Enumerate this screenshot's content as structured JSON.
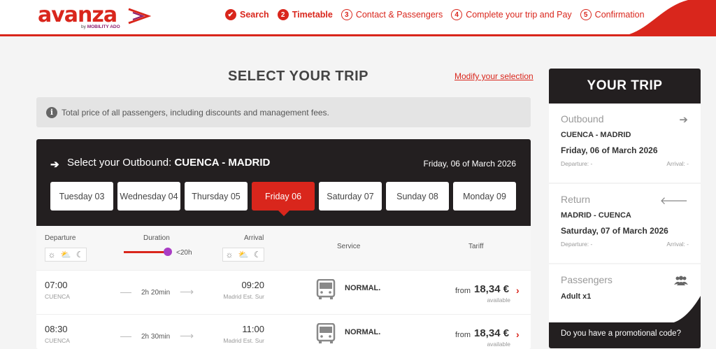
{
  "brand": {
    "name": "avanza",
    "sub_prefix": "by",
    "sub_brand": "MOBILITY ADO"
  },
  "steps": [
    {
      "num": "✔",
      "label": "Search",
      "state": "done"
    },
    {
      "num": "2",
      "label": "Timetable",
      "state": "active"
    },
    {
      "num": "3",
      "label": "Contact & Passengers",
      "state": "todo"
    },
    {
      "num": "4",
      "label": "Complete your trip and Pay",
      "state": "todo"
    },
    {
      "num": "5",
      "label": "Confirmation",
      "state": "todo"
    }
  ],
  "main": {
    "title": "SELECT YOUR TRIP",
    "modify_link": "Modify your selection",
    "info_text": "Total price of all passengers, including discounts and management fees."
  },
  "outbound": {
    "label_prefix": "Select your Outbound:",
    "route": "CUENCA - MADRID",
    "date": "Friday, 06 of March 2026",
    "days": [
      "Tuesday 03",
      "Wednesday 04",
      "Thursday 05",
      "Friday 06",
      "Saturday 07",
      "Sunday 08",
      "Monday 09"
    ],
    "active_day_index": 3
  },
  "columns": {
    "departure": "Departure",
    "duration": "Duration",
    "duration_max": "<20h",
    "arrival": "Arrival",
    "service": "Service",
    "tariff": "Tariff"
  },
  "trips": [
    {
      "dep_time": "07:00",
      "dep_city": "CUENCA",
      "duration": "2h 20min",
      "arr_time": "09:20",
      "arr_city": "Madrid Est. Sur",
      "service": "NORMAL.",
      "from": "from",
      "price": "18,34 €",
      "availability": "available"
    },
    {
      "dep_time": "08:30",
      "dep_city": "CUENCA",
      "duration": "2h 30min",
      "arr_time": "11:00",
      "arr_city": "Madrid Est. Sur",
      "service": "NORMAL.",
      "from": "from",
      "price": "18,34 €",
      "availability": "available"
    }
  ],
  "your_trip": {
    "title": "YOUR TRIP",
    "outbound": {
      "label": "Outbound",
      "route": "CUENCA - MADRID",
      "date": "Friday, 06 of March 2026",
      "departure": "Departure: -",
      "arrival": "Arrival: -"
    },
    "return": {
      "label": "Return",
      "route": "MADRID - CUENCA",
      "date": "Saturday, 07 of March 2026",
      "departure": "Departure: -",
      "arrival": "Arrival: -"
    },
    "passengers": {
      "label": "Passengers",
      "value": "Adult x1"
    },
    "promo": "Do you have a promotional code?"
  },
  "colors": {
    "accent": "#d9261c",
    "dark": "#231f20",
    "slider_knob": "#a93cc4"
  }
}
